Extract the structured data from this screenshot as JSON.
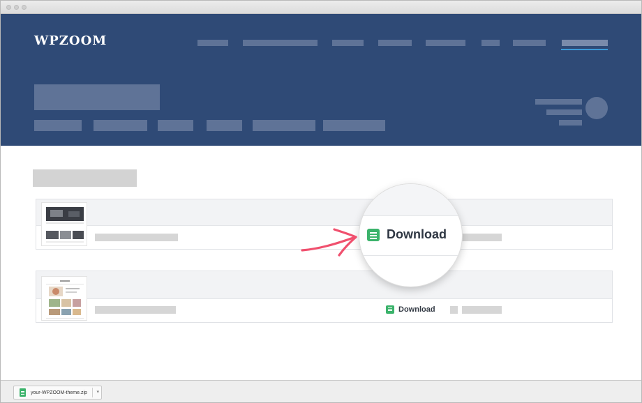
{
  "brand": {
    "logo_text": "WPZOOM"
  },
  "themes": [
    {
      "download_label": "Download"
    },
    {
      "download_label": "Download"
    }
  ],
  "downloads_bar": {
    "file_name": "your-WPZOOM-theme.zip",
    "menu_icon": "chevron-down-icon"
  },
  "colors": {
    "header_bg": "#2f4a76",
    "accent": "#3e9ad8",
    "download_icon": "#3bb36b",
    "arrow": "#f0506e"
  }
}
